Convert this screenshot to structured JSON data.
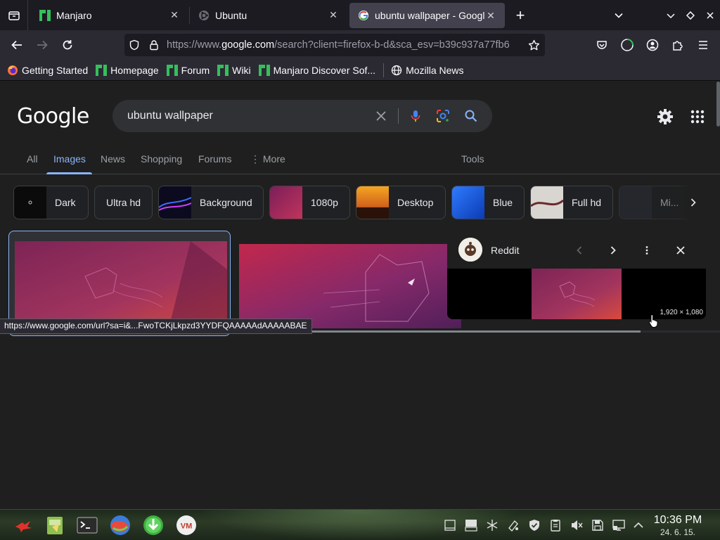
{
  "browser": {
    "tabs": [
      {
        "title": "Manjaro",
        "active": false
      },
      {
        "title": "Ubuntu",
        "active": false
      },
      {
        "title": "ubuntu wallpaper - Google Search",
        "active": true
      }
    ],
    "new_tab_symbol": "+",
    "url_prefix": "https://www.",
    "url_domain": "google.com",
    "url_rest": "/search?client=firefox-b-d&sca_esv=b39c937a77fb6",
    "bookmarks": [
      {
        "label": "Getting Started",
        "icon": "firefox-icon"
      },
      {
        "label": "Homepage",
        "icon": "manjaro-icon"
      },
      {
        "label": "Forum",
        "icon": "manjaro-icon"
      },
      {
        "label": "Wiki",
        "icon": "manjaro-icon"
      },
      {
        "label": "Manjaro Discover Sof...",
        "icon": "manjaro-icon"
      },
      {
        "label": "Mozilla News",
        "icon": "globe-icon"
      }
    ],
    "status_link": "https://www.google.com/url?sa=i&...FwoTCKjLkpzd3YYDFQAAAAAdAAAAABAE"
  },
  "google": {
    "logo": "Google",
    "query": "ubuntu wallpaper",
    "tabs": [
      "All",
      "Images",
      "News",
      "Shopping",
      "Forums",
      "More",
      "Tools"
    ],
    "active_tab": "Images",
    "chips": [
      "Dark",
      "Ultra hd",
      "Background",
      "1080p",
      "Desktop",
      "Blue",
      "Full hd",
      "Mi..."
    ],
    "hover": {
      "source": "Reddit",
      "dimensions": "1,920 × 1,080"
    },
    "load_progress": 0.89
  },
  "taskbar": {
    "time": "10:36 PM",
    "date": "24. 6. 15.",
    "apps": [
      "manjaro-menu-icon",
      "file-manager-icon",
      "terminal-icon",
      "browser-icon",
      "download-icon",
      "vm-icon"
    ]
  },
  "colors": {
    "accent": "#8ab4f8",
    "page_bg": "#1f1f1f",
    "tab_bg": "#1c1b22",
    "toolbar_bg": "#2b2a33",
    "manjaro_green": "#35bf5c"
  }
}
